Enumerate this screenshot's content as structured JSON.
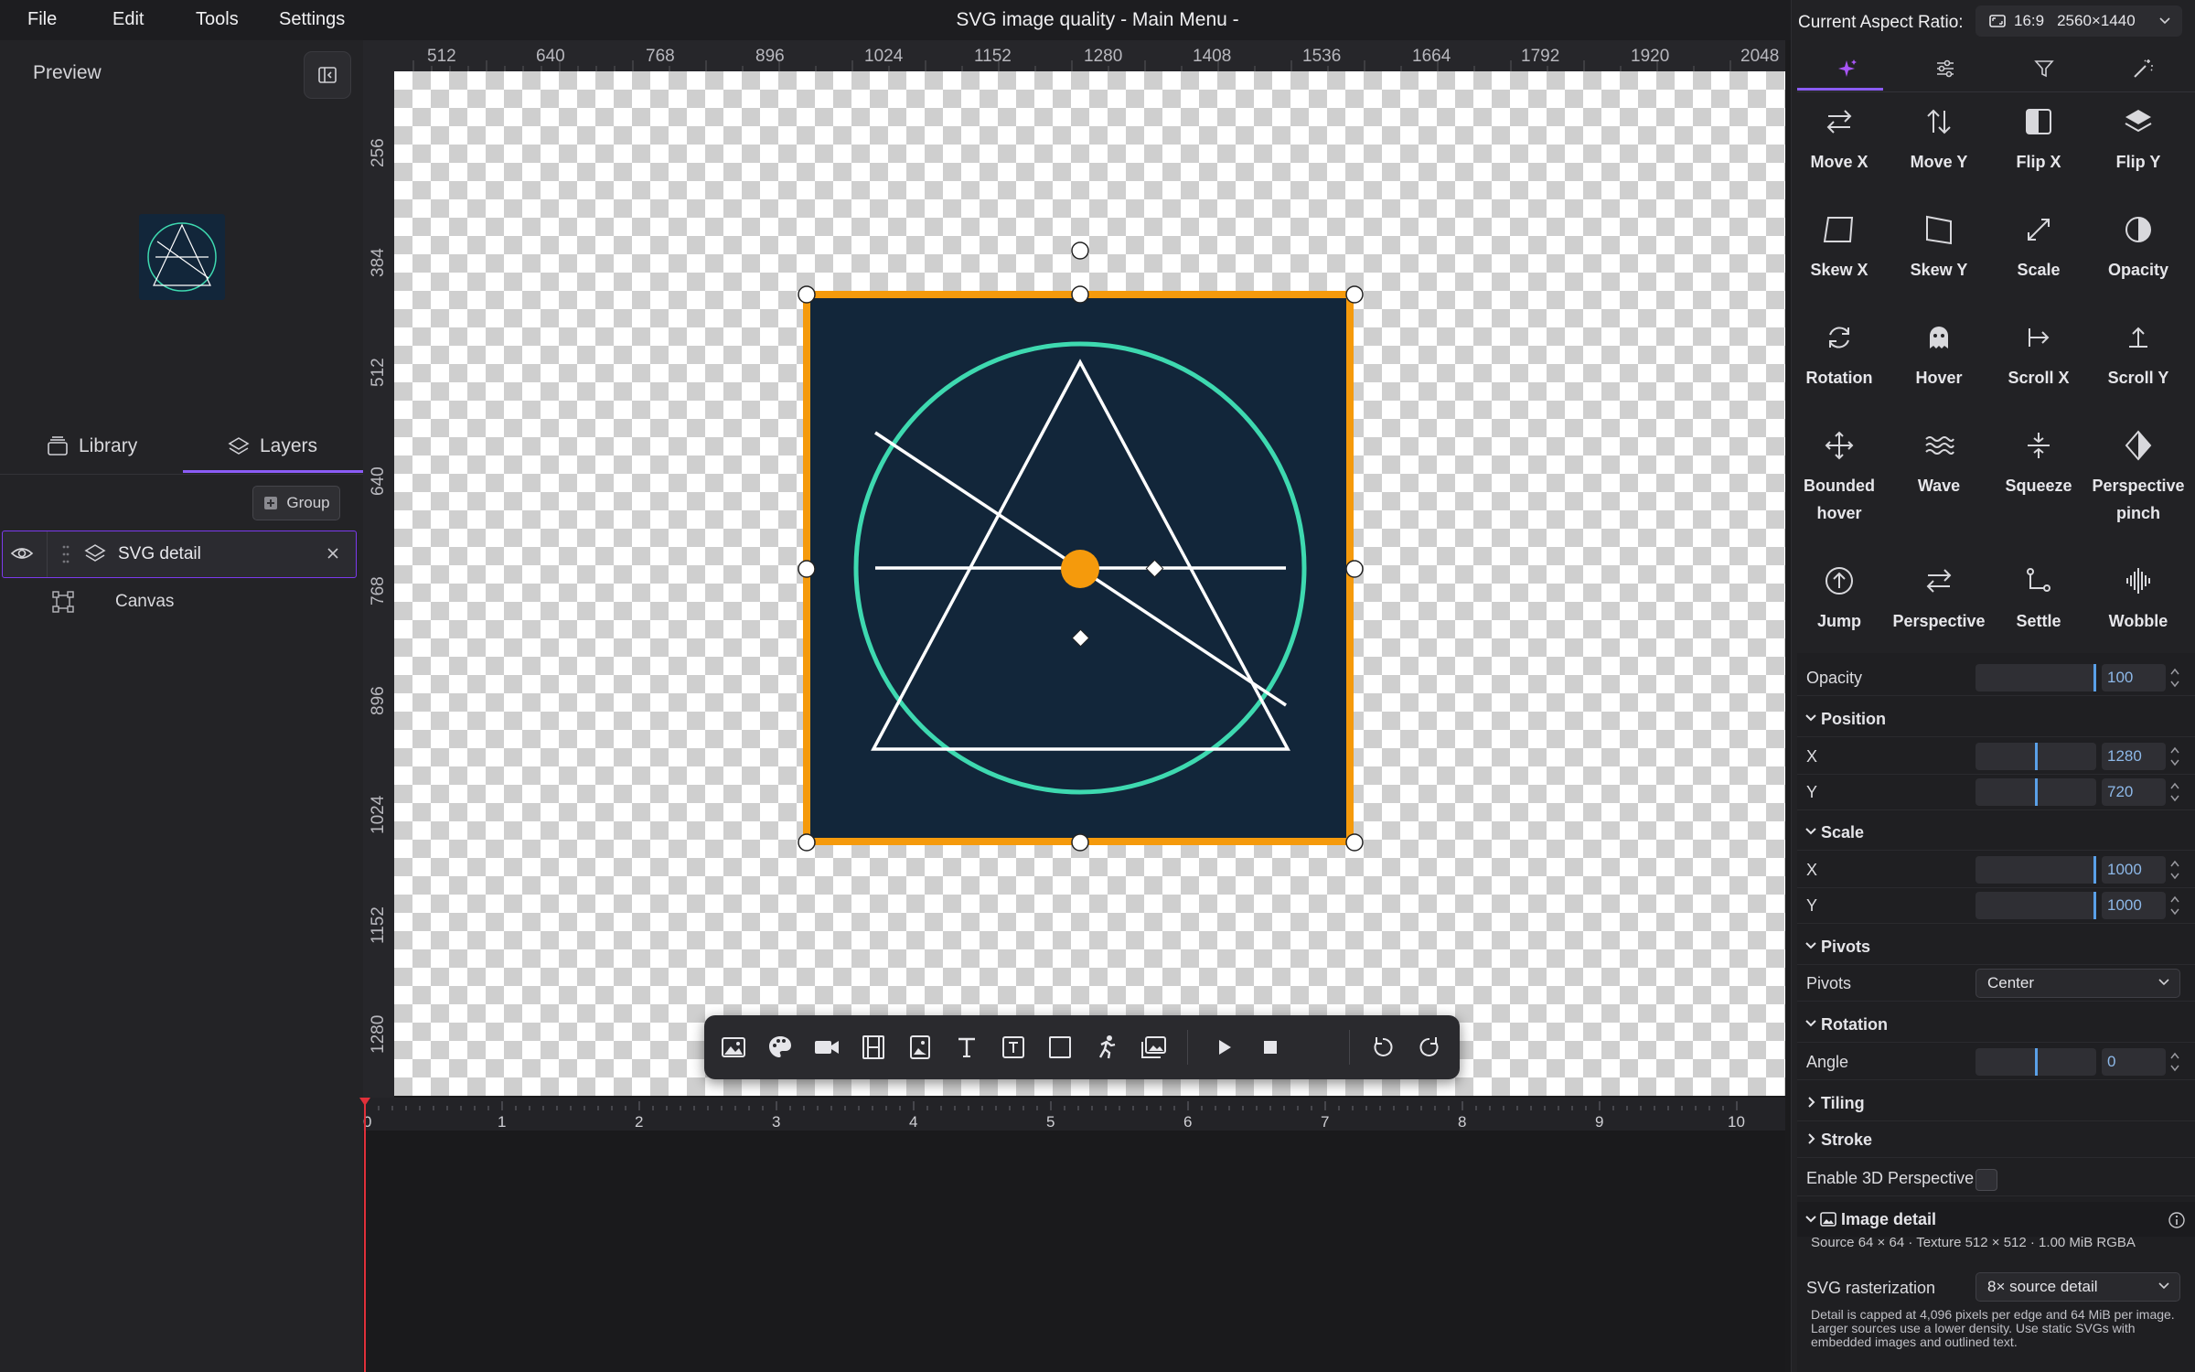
{
  "menu": {
    "file": "File",
    "edit": "Edit",
    "tools": "Tools",
    "settings": "Settings"
  },
  "app_title": "SVG image quality - Main Menu -",
  "sidebar": {
    "preview_label": "Preview",
    "tab_library": "Library",
    "tab_layers": "Layers",
    "group_button": "Group",
    "layers": [
      {
        "name": "SVG detail"
      },
      {
        "name": "Canvas"
      }
    ]
  },
  "ruler_h": [
    "512",
    "640",
    "768",
    "896",
    "1024",
    "1152",
    "1280",
    "1408",
    "1536",
    "1664",
    "1792",
    "1920",
    "2048"
  ],
  "ruler_v": [
    "256",
    "384",
    "512",
    "640",
    "768",
    "896",
    "1024",
    "1152",
    "1280"
  ],
  "timeline_ticks": [
    "0",
    "1",
    "2",
    "3",
    "4",
    "5",
    "6",
    "7",
    "8",
    "9",
    "10"
  ],
  "colors": {
    "accent": "#7c3aed",
    "selection": "#f59a0c",
    "svg_background": "#12263a",
    "circle": "#3ed9b0",
    "playhead": "#e0303a"
  },
  "toolbar_icons": [
    "image-icon",
    "palette-icon",
    "video-camera-icon",
    "film-icon",
    "picture-icon",
    "text-icon",
    "text-box-icon",
    "rectangle-icon",
    "runner-icon",
    "gallery-icon",
    "play-icon",
    "stop-icon",
    "undo-icon",
    "redo-icon"
  ],
  "aspect": {
    "label": "Current Aspect Ratio:",
    "ratio": "16:9",
    "resolution": "2560×1440"
  },
  "effects": [
    {
      "label": "Move X",
      "icon": "move-x-icon"
    },
    {
      "label": "Move Y",
      "icon": "move-y-icon"
    },
    {
      "label": "Flip X",
      "icon": "flip-x-icon"
    },
    {
      "label": "Flip Y",
      "icon": "flip-y-icon"
    },
    {
      "label": "Skew X",
      "icon": "skew-x-icon"
    },
    {
      "label": "Skew Y",
      "icon": "skew-y-icon"
    },
    {
      "label": "Scale",
      "icon": "scale-icon"
    },
    {
      "label": "Opacity",
      "icon": "opacity-icon"
    },
    {
      "label": "Rotation",
      "icon": "rotation-icon"
    },
    {
      "label": "Hover",
      "icon": "ghost-icon"
    },
    {
      "label": "Scroll X",
      "icon": "scroll-x-icon"
    },
    {
      "label": "Scroll Y",
      "icon": "scroll-y-icon"
    },
    {
      "label": "Bounded hover",
      "icon": "bounded-hover-icon"
    },
    {
      "label": "Wave",
      "icon": "wave-icon"
    },
    {
      "label": "Squeeze",
      "icon": "squeeze-icon"
    },
    {
      "label": "Perspective pinch",
      "icon": "perspective-pinch-icon"
    },
    {
      "label": "Jump",
      "icon": "jump-icon"
    },
    {
      "label": "Perspective",
      "icon": "perspective-icon"
    },
    {
      "label": "Settle",
      "icon": "settle-icon"
    },
    {
      "label": "Wobble",
      "icon": "wobble-icon"
    }
  ],
  "properties": {
    "opacity_label": "Opacity",
    "opacity": "100",
    "opacity_level": 1.0,
    "position_title": "Position",
    "x_label": "X",
    "y_label": "Y",
    "position_x": "1280",
    "position_y": "720",
    "position_x_level": 0.5,
    "position_y_level": 0.5,
    "scale_title": "Scale",
    "scale_x": "1000",
    "scale_y": "1000",
    "scale_x_level": 1.0,
    "scale_y_level": 1.0,
    "pivots_title": "Pivots",
    "pivots_label": "Pivots",
    "pivots_value": "Center",
    "rotation_title": "Rotation",
    "angle_label": "Angle",
    "angle": "0",
    "angle_level": 0.5,
    "tiling_title": "Tiling",
    "stroke_title": "Stroke",
    "enable_3d_label": "Enable 3D Perspective",
    "image_detail_title": "Image detail",
    "source_info": "Source 64 × 64 · Texture 512 × 512 · 1.00 MiB RGBA",
    "svg_rasterization_label": "SVG rasterization",
    "svg_rasterization_value": "8× source detail",
    "detail_note": "Detail is capped at 4,096 pixels per edge and 64 MiB per image. Larger sources use a lower density. Use static SVGs with embedded images and outlined text."
  }
}
